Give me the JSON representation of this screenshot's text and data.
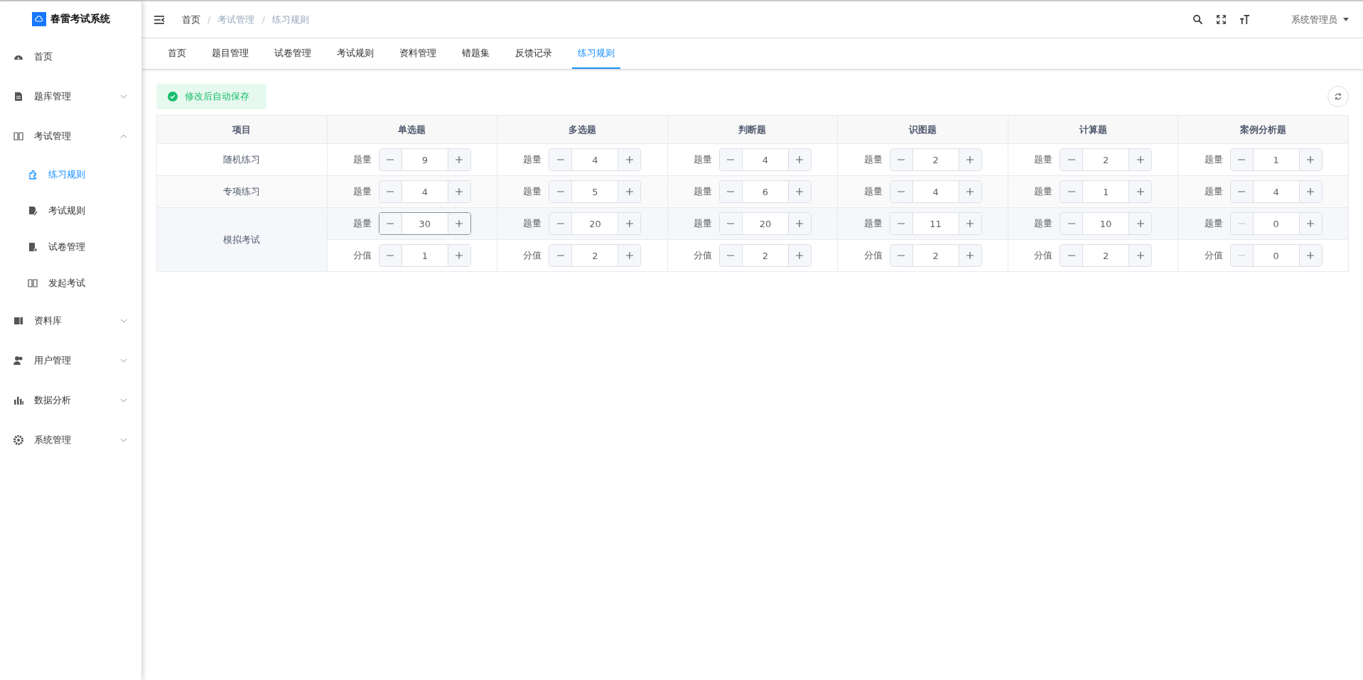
{
  "sidebar": {
    "logo": "春雷考试系统",
    "items": [
      {
        "label": "首页",
        "selected": false
      },
      {
        "label": "题库管理",
        "expanded": false,
        "selected": false
      },
      {
        "label": "考试管理",
        "expanded": true,
        "selected": false,
        "children": [
          {
            "label": "练习规则",
            "selected": true
          },
          {
            "label": "考试规则",
            "selected": false
          },
          {
            "label": "试卷管理",
            "selected": false
          },
          {
            "label": "发起考试",
            "selected": false
          }
        ]
      },
      {
        "label": "资料库",
        "expanded": false,
        "selected": false
      },
      {
        "label": "用户管理",
        "expanded": false,
        "selected": false
      },
      {
        "label": "数据分析",
        "expanded": false,
        "selected": false
      },
      {
        "label": "系统管理",
        "expanded": false,
        "selected": false
      }
    ]
  },
  "breadcrumb": [
    {
      "label": "首页"
    },
    {
      "separator": "/",
      "label": "考试管理"
    },
    {
      "separator": "/",
      "label": "练习规则"
    }
  ],
  "user": "系统管理员",
  "tabs": [
    {
      "label": "首页",
      "selected": false
    },
    {
      "label": "题目管理",
      "selected": false
    },
    {
      "label": "试卷管理",
      "selected": false
    },
    {
      "label": "考试规则",
      "selected": false
    },
    {
      "label": "资料管理",
      "selected": false
    },
    {
      "label": "错题集",
      "selected": false
    },
    {
      "label": "反馈记录",
      "selected": false
    },
    {
      "label": "练习规则",
      "selected": true
    }
  ],
  "notice": "修改后自动保存",
  "table": {
    "columns": [
      "项目",
      "单选题",
      "多选题",
      "判断题",
      "识图题",
      "计算题",
      "案例分析题"
    ],
    "rows": [
      {
        "label": "随机练习",
        "lines": [
          [
            {
              "label": "题量",
              "value": "9",
              "minus_disabled": false,
              "focused": false
            },
            {
              "label": "题量",
              "value": "4",
              "minus_disabled": false,
              "focused": false
            },
            {
              "label": "题量",
              "value": "4",
              "minus_disabled": false,
              "focused": false
            },
            {
              "label": "题量",
              "value": "2",
              "minus_disabled": false,
              "focused": false
            },
            {
              "label": "题量",
              "value": "2",
              "minus_disabled": false,
              "focused": false
            },
            {
              "label": "题量",
              "value": "1",
              "minus_disabled": false,
              "focused": false
            }
          ]
        ]
      },
      {
        "label": "专项练习",
        "lines": [
          [
            {
              "label": "题量",
              "value": "4",
              "minus_disabled": false,
              "focused": false
            },
            {
              "label": "题量",
              "value": "5",
              "minus_disabled": false,
              "focused": false
            },
            {
              "label": "题量",
              "value": "6",
              "minus_disabled": false,
              "focused": false
            },
            {
              "label": "题量",
              "value": "4",
              "minus_disabled": false,
              "focused": false
            },
            {
              "label": "题量",
              "value": "1",
              "minus_disabled": false,
              "focused": false
            },
            {
              "label": "题量",
              "value": "4",
              "minus_disabled": false,
              "focused": false
            }
          ]
        ]
      },
      {
        "label": "模拟考试",
        "lines": [
          [
            {
              "label": "题量",
              "value": "30",
              "minus_disabled": false,
              "focused": true
            },
            {
              "label": "题量",
              "value": "20",
              "minus_disabled": false,
              "focused": false
            },
            {
              "label": "题量",
              "value": "20",
              "minus_disabled": false,
              "focused": false
            },
            {
              "label": "题量",
              "value": "11",
              "minus_disabled": false,
              "focused": false
            },
            {
              "label": "题量",
              "value": "10",
              "minus_disabled": false,
              "focused": false
            },
            {
              "label": "题量",
              "value": "0",
              "minus_disabled": true,
              "focused": false
            }
          ],
          [
            {
              "label": "分值",
              "value": "1",
              "minus_disabled": false,
              "focused": false
            },
            {
              "label": "分值",
              "value": "2",
              "minus_disabled": false,
              "focused": false
            },
            {
              "label": "分值",
              "value": "2",
              "minus_disabled": false,
              "focused": false
            },
            {
              "label": "分值",
              "value": "2",
              "minus_disabled": false,
              "focused": false
            },
            {
              "label": "分值",
              "value": "2",
              "minus_disabled": false,
              "focused": false
            },
            {
              "label": "分值",
              "value": "0",
              "minus_disabled": true,
              "focused": false
            }
          ]
        ]
      }
    ]
  }
}
